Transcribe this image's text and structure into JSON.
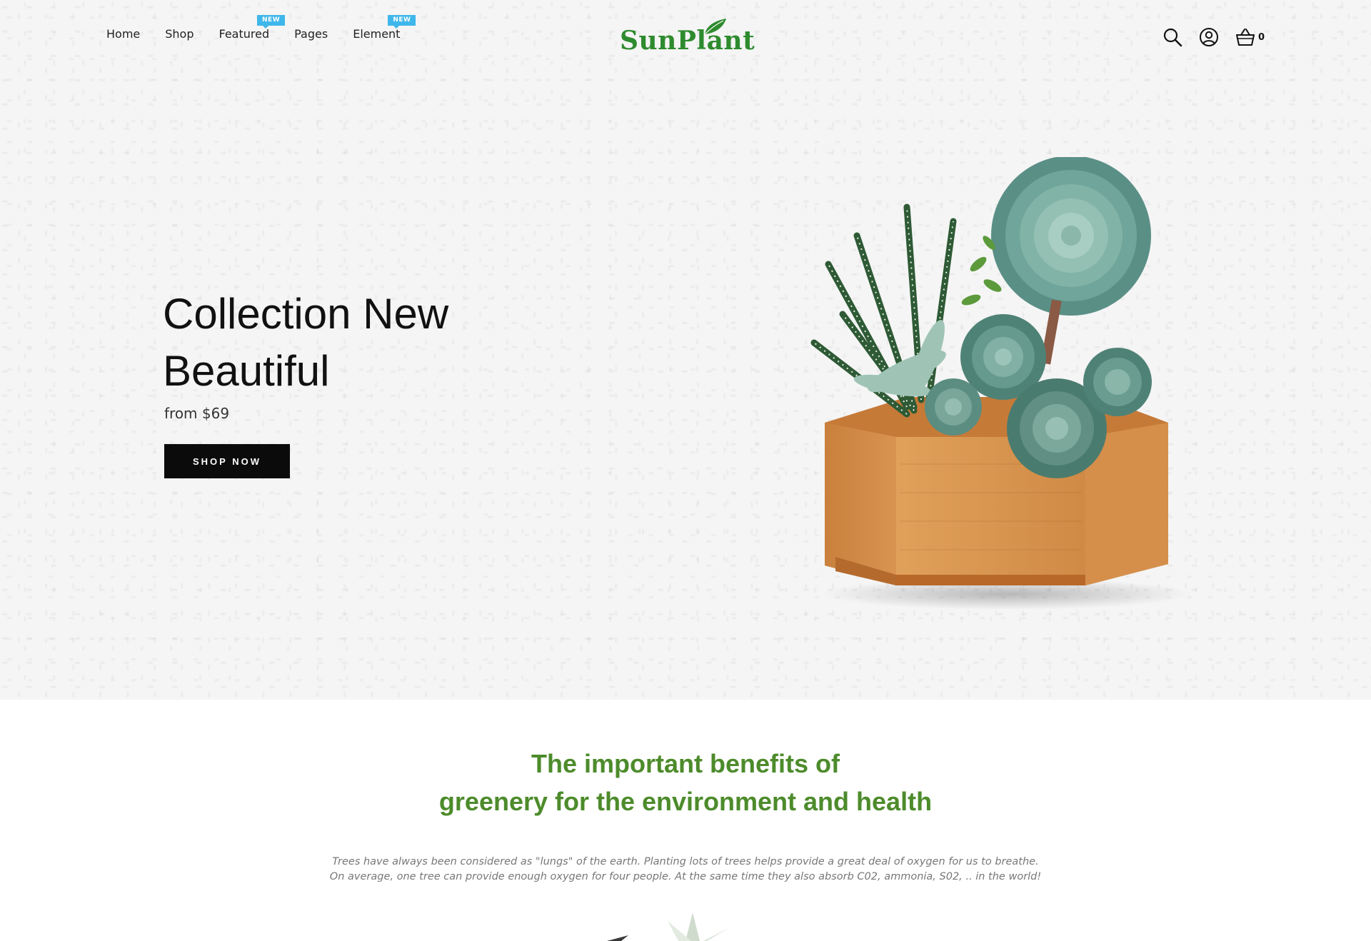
{
  "nav": {
    "items": [
      {
        "label": "Home",
        "badge": ""
      },
      {
        "label": "Shop",
        "badge": ""
      },
      {
        "label": "Featured",
        "badge": "NEW"
      },
      {
        "label": "Pages",
        "badge": ""
      },
      {
        "label": "Element",
        "badge": "NEW"
      }
    ]
  },
  "logo": {
    "text": "SunPlant"
  },
  "header": {
    "cart_count": "0",
    "icons": [
      "search-icon",
      "user-icon",
      "cart-icon"
    ]
  },
  "hero": {
    "title_line1": "Collection New",
    "title_line2": "Beautiful",
    "price": "from $69",
    "button": "SHOP NOW"
  },
  "benefits": {
    "title_line1": "The important benefits of",
    "title_line2": "greenery for the environment and health",
    "text_line1": "Trees have always been considered as \"lungs\" of the earth. Planting lots of trees helps provide a great deal of oxygen for us to breathe.",
    "text_line2": "On average, one tree can provide enough oxygen for four people. At the same time they also absorb C02, ammonia, S02, .. in the world!"
  },
  "colors": {
    "brand_green": "#2e8b2e",
    "heading_green": "#4d8b2b",
    "badge_blue": "#3fb7ea",
    "button_black": "#0b0b0b"
  }
}
